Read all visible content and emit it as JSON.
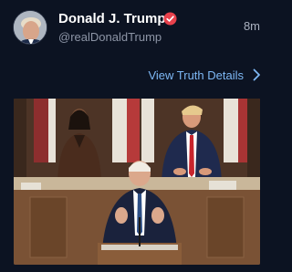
{
  "post": {
    "author": {
      "display_name": "Donald J. Trump",
      "handle": "@realDonaldTrump",
      "verified": true,
      "avatar_icon": "user-avatar-photo"
    },
    "timestamp": "8m",
    "details_link": {
      "label": "View Truth Details",
      "icon": "chevron-right-icon"
    },
    "media": {
      "type": "photo",
      "icon": "photo-image"
    }
  },
  "colors": {
    "background": "#0c1322",
    "accent_link": "#7eb8f5",
    "verified_badge": "#e8414c",
    "handle_text": "#8d95a6"
  }
}
